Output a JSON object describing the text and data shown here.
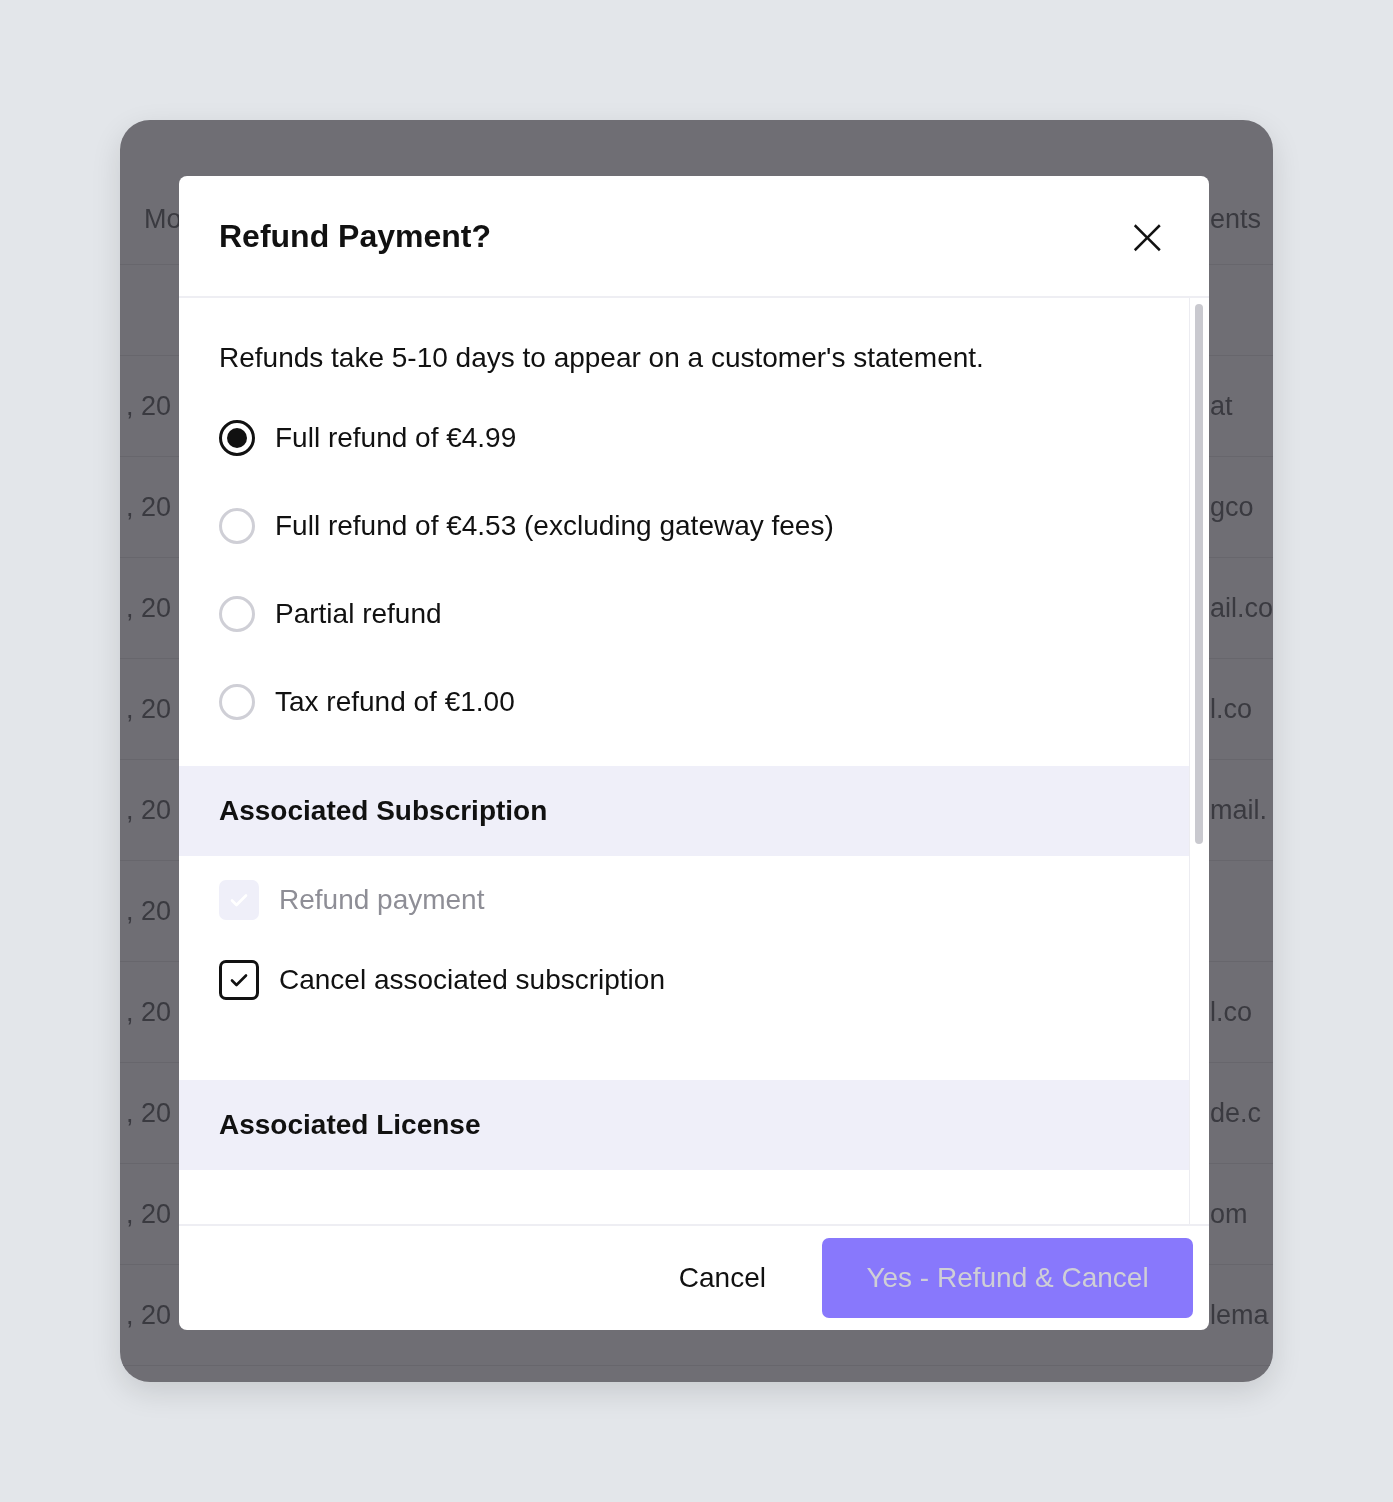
{
  "background_table": {
    "header": {
      "column_1": "Mo",
      "column_2": "ents"
    },
    "rows": [
      {
        "column_1": ", 20",
        "column_2": "at"
      },
      {
        "column_1": ", 20",
        "column_2": "gco"
      },
      {
        "column_1": ", 20",
        "column_2": "ail.co"
      },
      {
        "column_1": ", 20",
        "column_2": "l.co"
      },
      {
        "column_1": ", 20",
        "column_2": "mail."
      },
      {
        "column_1": ", 20"
      },
      {
        "column_1": ", 20",
        "column_2": "l.co"
      },
      {
        "column_1": ", 20",
        "column_2": "de.c"
      },
      {
        "column_1": ", 20",
        "column_2": "om"
      },
      {
        "column_1": ", 20",
        "column_2": "lema"
      }
    ]
  },
  "dialog": {
    "title": "Refund Payment?",
    "close_icon": "×",
    "description": "Refunds take 5-10 days to appear on a customer's statement.",
    "refund_options": [
      {
        "label": "Full refund of €4.99",
        "selected": true
      },
      {
        "label": "Full refund of €4.53 (excluding gateway fees)",
        "selected": false
      },
      {
        "label": "Partial refund",
        "selected": false
      },
      {
        "label": "Tax refund of €1.00",
        "selected": false
      }
    ],
    "sections": [
      {
        "title": "Associated Subscription",
        "checkboxes": [
          {
            "label": "Refund payment",
            "checked": true,
            "disabled": true
          },
          {
            "label": "Cancel associated subscription",
            "checked": true,
            "disabled": false
          }
        ]
      },
      {
        "title": "Associated License"
      }
    ],
    "cancel_button": "Cancel",
    "confirm_button": {
      "label": "Yes - Refund & Cancel",
      "disabled": true
    }
  }
}
